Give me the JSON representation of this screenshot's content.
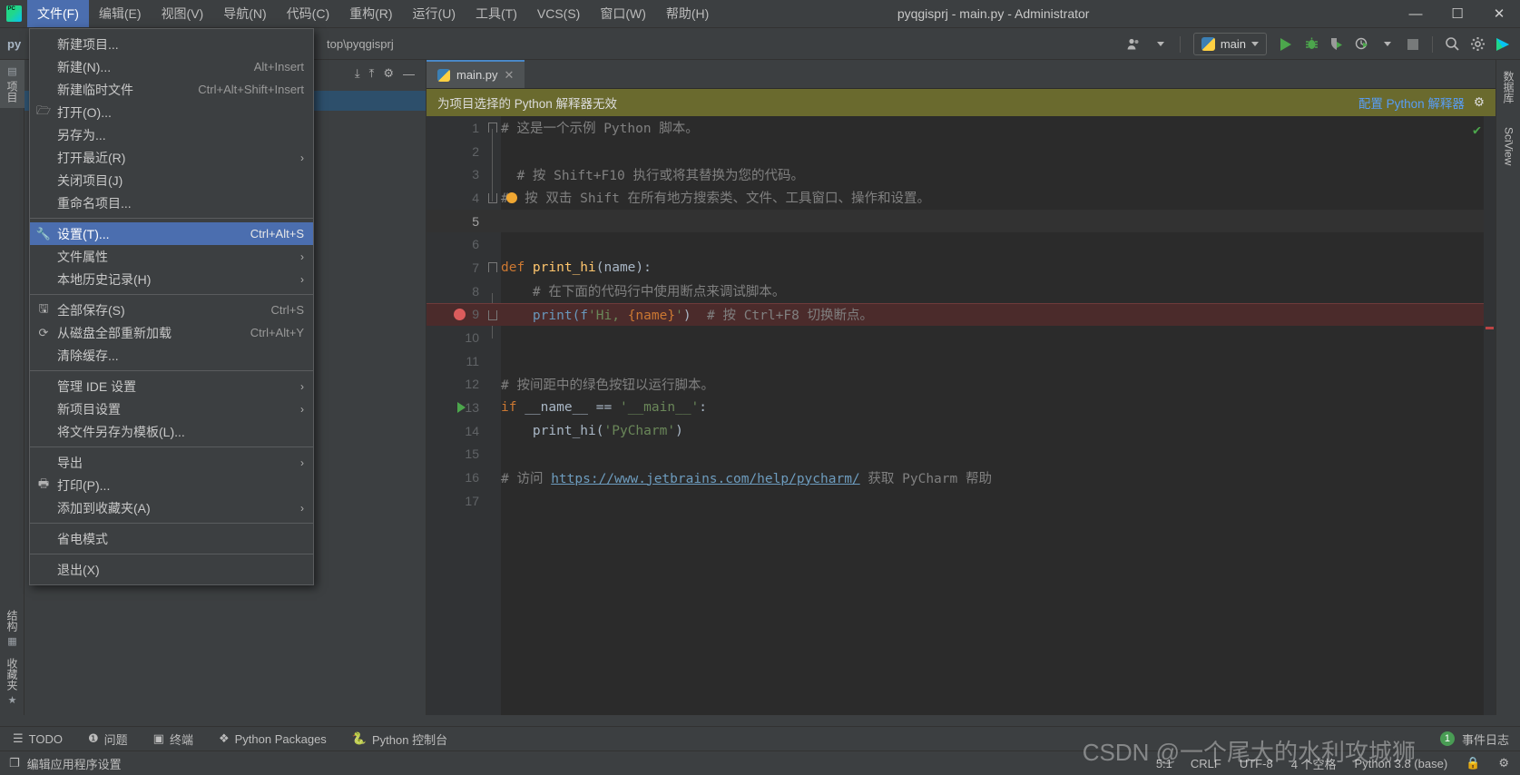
{
  "window": {
    "title": "pyqgisprj - main.py - Administrator",
    "minimize": "—",
    "maximize": "☐",
    "close": "✕",
    "logo_text": "PC"
  },
  "menubar": {
    "items": [
      {
        "label": "文件(F)",
        "active": true,
        "name": "menu-file"
      },
      {
        "label": "编辑(E)",
        "active": false,
        "name": "menu-edit"
      },
      {
        "label": "视图(V)",
        "active": false,
        "name": "menu-view"
      },
      {
        "label": "导航(N)",
        "active": false,
        "name": "menu-navigate"
      },
      {
        "label": "代码(C)",
        "active": false,
        "name": "menu-code"
      },
      {
        "label": "重构(R)",
        "active": false,
        "name": "menu-refactor"
      },
      {
        "label": "运行(U)",
        "active": false,
        "name": "menu-run"
      },
      {
        "label": "工具(T)",
        "active": false,
        "name": "menu-tools"
      },
      {
        "label": "VCS(S)",
        "active": false,
        "name": "menu-vcs"
      },
      {
        "label": "窗口(W)",
        "active": false,
        "name": "menu-window"
      },
      {
        "label": "帮助(H)",
        "active": false,
        "name": "menu-help"
      }
    ]
  },
  "file_menu": {
    "items": [
      {
        "icon": "",
        "label": "新建项目...",
        "shortcut": "",
        "arrow": false,
        "selected": false,
        "sep_after": false
      },
      {
        "icon": "",
        "label": "新建(N)...",
        "shortcut": "Alt+Insert",
        "arrow": false,
        "selected": false,
        "sep_after": false
      },
      {
        "icon": "",
        "label": "新建临时文件",
        "shortcut": "Ctrl+Alt+Shift+Insert",
        "arrow": false,
        "selected": false,
        "sep_after": false
      },
      {
        "icon": "folder",
        "label": "打开(O)...",
        "shortcut": "",
        "arrow": false,
        "selected": false,
        "sep_after": false
      },
      {
        "icon": "",
        "label": "另存为...",
        "shortcut": "",
        "arrow": false,
        "selected": false,
        "sep_after": false
      },
      {
        "icon": "",
        "label": "打开最近(R)",
        "shortcut": "",
        "arrow": true,
        "selected": false,
        "sep_after": false
      },
      {
        "icon": "",
        "label": "关闭项目(J)",
        "shortcut": "",
        "arrow": false,
        "selected": false,
        "sep_after": false
      },
      {
        "icon": "",
        "label": "重命名项目...",
        "shortcut": "",
        "arrow": false,
        "selected": false,
        "sep_after": true
      },
      {
        "icon": "wrench",
        "label": "设置(T)...",
        "shortcut": "Ctrl+Alt+S",
        "arrow": false,
        "selected": true,
        "sep_after": false
      },
      {
        "icon": "",
        "label": "文件属性",
        "shortcut": "",
        "arrow": true,
        "selected": false,
        "sep_after": false
      },
      {
        "icon": "",
        "label": "本地历史记录(H)",
        "shortcut": "",
        "arrow": true,
        "selected": false,
        "sep_after": true
      },
      {
        "icon": "save",
        "label": "全部保存(S)",
        "shortcut": "Ctrl+S",
        "arrow": false,
        "selected": false,
        "sep_after": false
      },
      {
        "icon": "reload",
        "label": "从磁盘全部重新加载",
        "shortcut": "Ctrl+Alt+Y",
        "arrow": false,
        "selected": false,
        "sep_after": false
      },
      {
        "icon": "",
        "label": "清除缓存...",
        "shortcut": "",
        "arrow": false,
        "selected": false,
        "sep_after": true
      },
      {
        "icon": "",
        "label": "管理 IDE 设置",
        "shortcut": "",
        "arrow": true,
        "selected": false,
        "sep_after": false
      },
      {
        "icon": "",
        "label": "新项目设置",
        "shortcut": "",
        "arrow": true,
        "selected": false,
        "sep_after": false
      },
      {
        "icon": "",
        "label": "将文件另存为模板(L)...",
        "shortcut": "",
        "arrow": false,
        "selected": false,
        "sep_after": true
      },
      {
        "icon": "",
        "label": "导出",
        "shortcut": "",
        "arrow": true,
        "selected": false,
        "sep_after": false
      },
      {
        "icon": "print",
        "label": "打印(P)...",
        "shortcut": "",
        "arrow": false,
        "selected": false,
        "sep_after": false
      },
      {
        "icon": "",
        "label": "添加到收藏夹(A)",
        "shortcut": "",
        "arrow": true,
        "selected": false,
        "sep_after": true
      },
      {
        "icon": "",
        "label": "省电模式",
        "shortcut": "",
        "arrow": false,
        "selected": false,
        "sep_after": true
      },
      {
        "icon": "",
        "label": "退出(X)",
        "shortcut": "",
        "arrow": false,
        "selected": false,
        "sep_after": false
      }
    ]
  },
  "navbar": {
    "project_label": "py",
    "path": "top\\pyqgisprj",
    "run_config": "main",
    "account_icon": "user-icon",
    "search_icon": "search-icon",
    "settings_icon": "gear-icon"
  },
  "left_tool_strip": {
    "top": [
      {
        "label": "项目",
        "name": "tool-window-project",
        "selected": true
      }
    ],
    "bottom": [
      {
        "label": "结构",
        "name": "tool-window-structure",
        "selected": false
      },
      {
        "label": "收藏夹",
        "name": "tool-window-favorites",
        "selected": false
      }
    ]
  },
  "right_tool_strip": {
    "items": [
      {
        "label": "数据库",
        "name": "tool-window-database"
      },
      {
        "label": "SciView",
        "name": "tool-window-sciview"
      }
    ]
  },
  "editor": {
    "tab": {
      "label": "main.py",
      "close": "✕",
      "icon": "python-file-icon"
    },
    "notification": {
      "text": "为项目选择的 Python 解释器无效",
      "action": "配置 Python 解释器",
      "gear": "gear-icon"
    },
    "lines": [
      {
        "n": "1",
        "segments": [
          {
            "t": "# 这是一个示例 Python 脚本。",
            "c": "cmt"
          }
        ]
      },
      {
        "n": "2",
        "segments": []
      },
      {
        "n": "3",
        "segments": [
          {
            "t": "  # 按 Shift+F10 执行或将其替换为您的代码。",
            "c": "cmt"
          }
        ]
      },
      {
        "n": "4",
        "segments": [
          {
            "t": "#  按 双击 Shift 在所有地方搜索类、文件、工具窗口、操作和设置。",
            "c": "cmt"
          }
        ]
      },
      {
        "n": "5",
        "segments": [],
        "current": true
      },
      {
        "n": "6",
        "segments": []
      },
      {
        "n": "7",
        "segments": [
          {
            "t": "def ",
            "c": "kw"
          },
          {
            "t": "print_hi",
            "c": "fn"
          },
          {
            "t": "(name):",
            "c": "brace"
          }
        ]
      },
      {
        "n": "8",
        "segments": [
          {
            "t": "    # 在下面的代码行中使用断点来调试脚本。",
            "c": "cmt"
          }
        ]
      },
      {
        "n": "9",
        "segments": [
          {
            "t": "    print(f",
            "c": "num"
          },
          {
            "t": "'Hi, ",
            "c": "str"
          },
          {
            "t": "{name}",
            "c": "fstr-br"
          },
          {
            "t": "'",
            "c": "str"
          },
          {
            "t": ")",
            "c": "brace"
          },
          {
            "t": "  # 按 Ctrl+F8 切换断点。",
            "c": "cmt"
          }
        ],
        "breakpoint": true,
        "error": true
      },
      {
        "n": "10",
        "segments": []
      },
      {
        "n": "11",
        "segments": []
      },
      {
        "n": "12",
        "segments": [
          {
            "t": "# 按间距中的绿色按钮以运行脚本。",
            "c": "cmt"
          }
        ]
      },
      {
        "n": "13",
        "segments": [
          {
            "t": "if ",
            "c": "kw"
          },
          {
            "t": "__name__ ",
            "c": "brace"
          },
          {
            "t": "== ",
            "c": "brace"
          },
          {
            "t": "'__main__'",
            "c": "str"
          },
          {
            "t": ":",
            "c": "brace"
          }
        ],
        "runmark": true
      },
      {
        "n": "14",
        "segments": [
          {
            "t": "    print_hi(",
            "c": "brace"
          },
          {
            "t": "'PyCharm'",
            "c": "str"
          },
          {
            "t": ")",
            "c": "brace"
          }
        ]
      },
      {
        "n": "15",
        "segments": []
      },
      {
        "n": "16",
        "segments": [
          {
            "t": "# 访问 ",
            "c": "cmt"
          },
          {
            "t": "https://www.jetbrains.com/help/pycharm/",
            "c": "link"
          },
          {
            "t": " 获取 PyCharm 帮助",
            "c": "cmt"
          }
        ]
      },
      {
        "n": "17",
        "segments": []
      }
    ]
  },
  "bottom_bar": {
    "items": [
      {
        "label": "TODO",
        "icon": "list-icon",
        "name": "bottom-tab-todo"
      },
      {
        "label": "问题",
        "icon": "warning-icon",
        "name": "bottom-tab-problems"
      },
      {
        "label": "终端",
        "icon": "terminal-icon",
        "name": "bottom-tab-terminal"
      },
      {
        "label": "Python Packages",
        "icon": "packages-icon",
        "name": "bottom-tab-python-packages"
      },
      {
        "label": "Python 控制台",
        "icon": "python-icon",
        "name": "bottom-tab-python-console"
      }
    ],
    "event_log": {
      "label": "事件日志",
      "count": "1"
    }
  },
  "status_bar": {
    "left_text": "编辑应用程序设置",
    "left_icon": "copy-icon",
    "caret": "5:1",
    "line_sep": "CRLF",
    "encoding": "UTF-8",
    "indent": "4 个空格",
    "interpreter": "Python 3.8 (base)",
    "lock_icon": "lock-icon",
    "gear_icon": "gear-icon"
  },
  "watermark": "CSDN @一个尾大的水利攻城狮",
  "colors": {
    "accent": "#4b6eaf",
    "editor_bg": "#2b2b2b",
    "panel_bg": "#3c3f41",
    "notification_bg": "#6a6a2e",
    "keyword": "#cc7832",
    "string": "#6a8759",
    "comment": "#808080",
    "function": "#ffc66d",
    "breakpoint": "#db5c5c",
    "run_green": "#4ca64c"
  }
}
